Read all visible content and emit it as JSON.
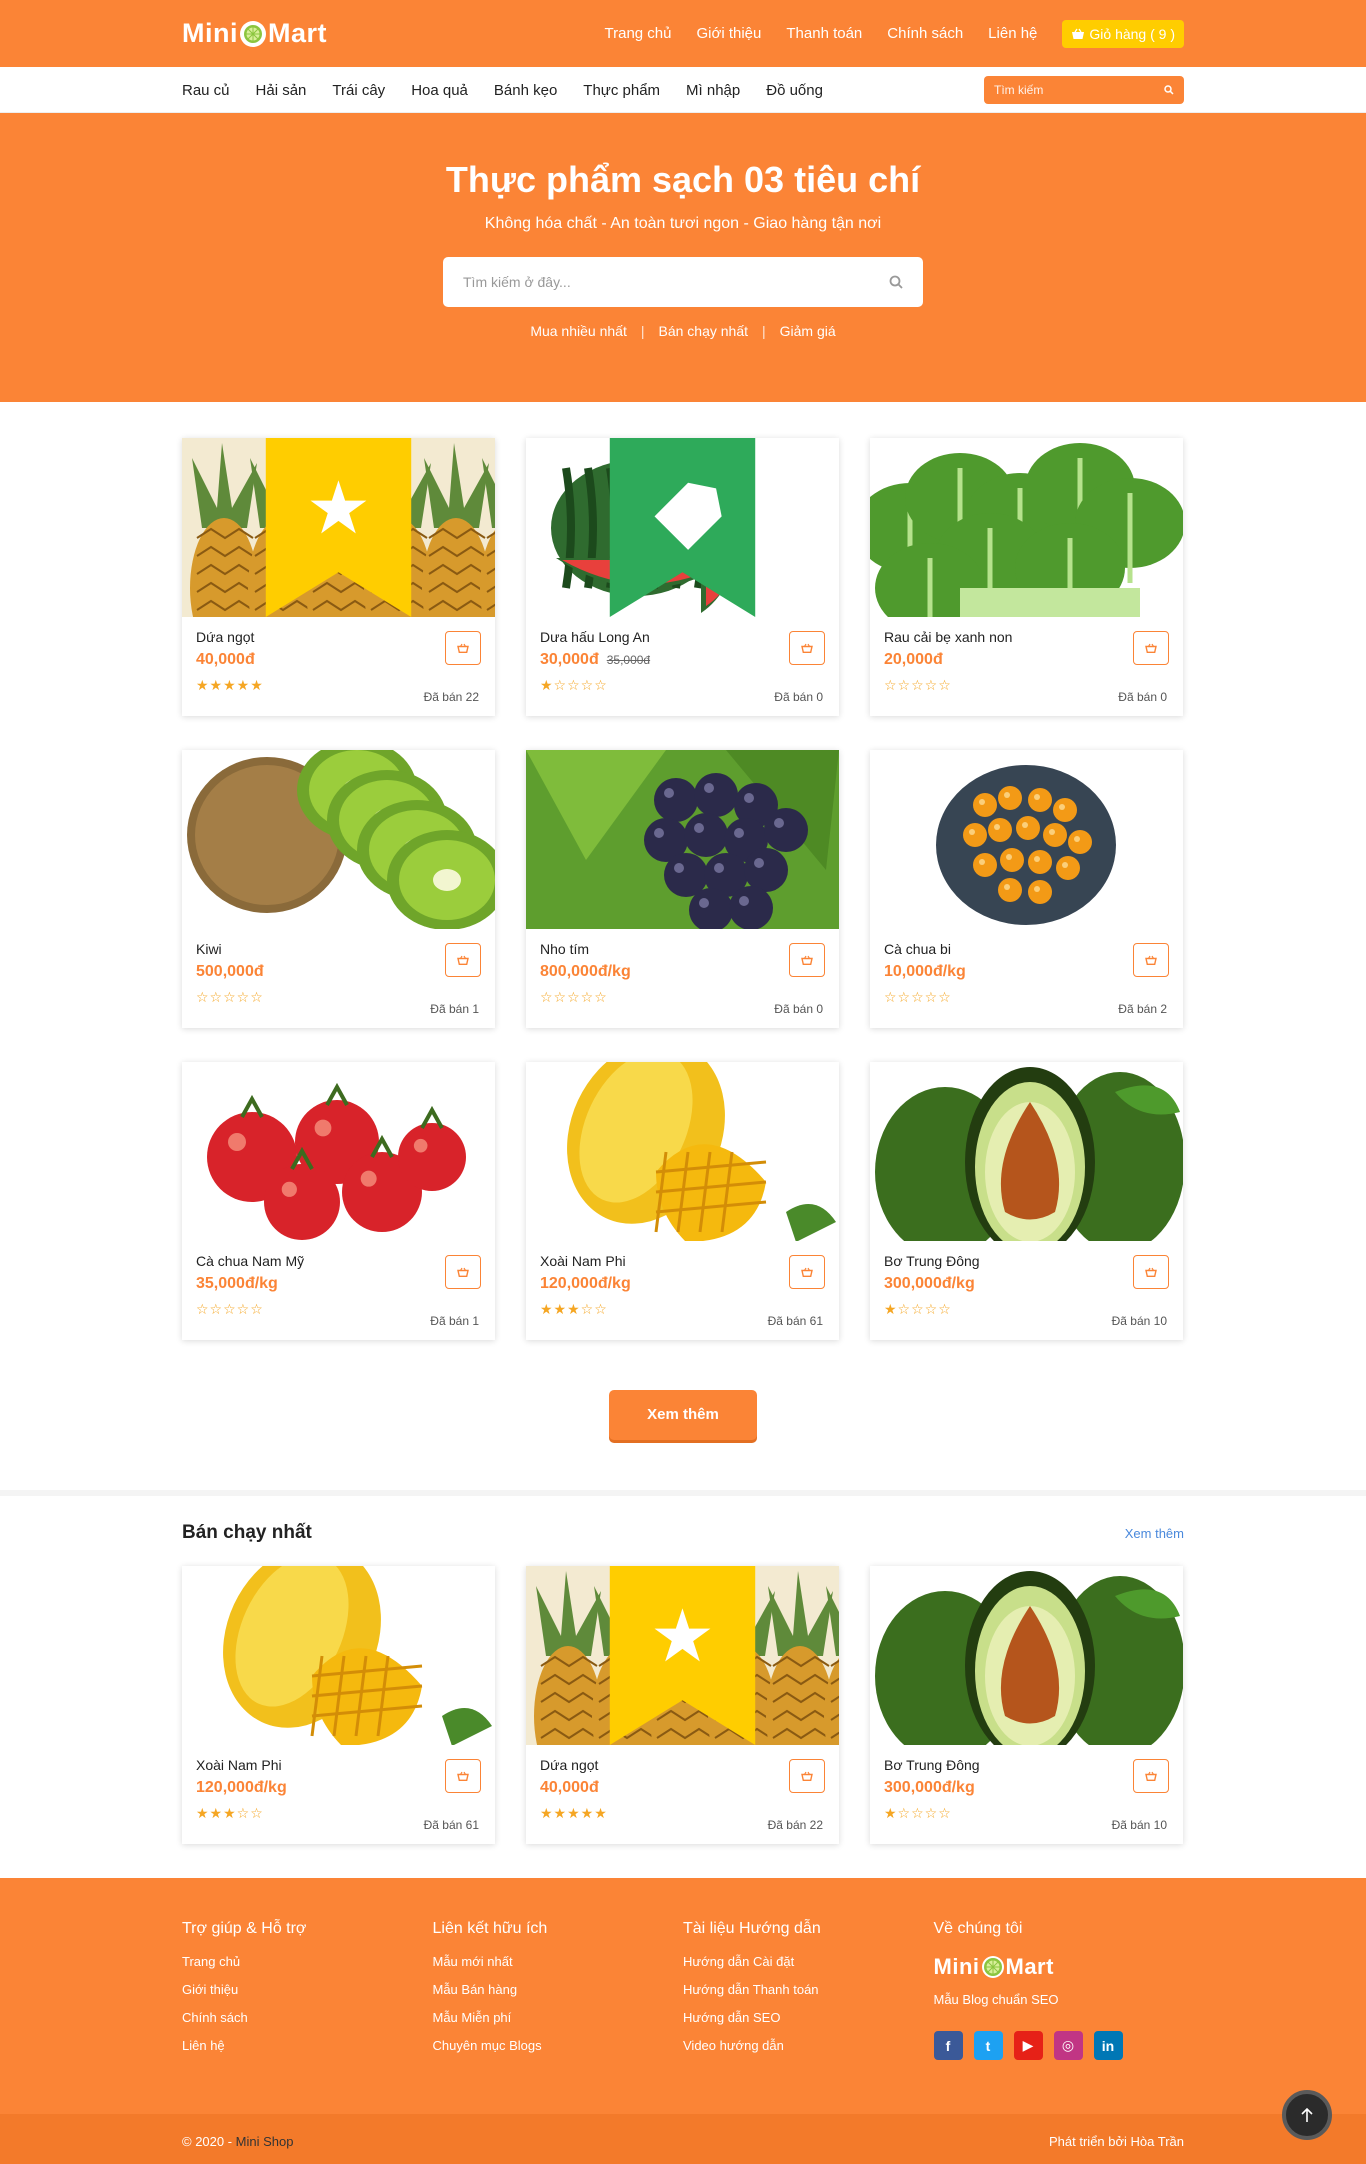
{
  "brand": {
    "part1": "Mini",
    "part2": "Mart"
  },
  "topnav": {
    "items": [
      "Trang chủ",
      "Giới thiệu",
      "Thanh toán",
      "Chính sách",
      "Liên hệ"
    ],
    "cart_label": "Giỏ hàng ( 9 )"
  },
  "catnav": {
    "items": [
      "Rau củ",
      "Hải sản",
      "Trái cây",
      "Hoa quả",
      "Bánh kẹo",
      "Thực phẩm",
      "Mì nhập",
      "Đồ uống"
    ],
    "search_placeholder": "Tìm kiếm"
  },
  "hero": {
    "title": "Thực phẩm sạch 03 tiêu chí",
    "subtitle": "Không hóa chất - An toàn tươi ngon - Giao hàng tận nơi",
    "search_placeholder": "Tìm kiếm ở đây...",
    "links": [
      "Mua nhiều nhất",
      "Bán chạy nhất",
      "Giảm giá"
    ]
  },
  "products": [
    {
      "name": "Dứa ngọt",
      "price": "40,000đ",
      "old_price": "",
      "rating": 5,
      "sold": "Đã bán 22",
      "image": "pineapple",
      "badge": "star"
    },
    {
      "name": "Dưa hấu Long An",
      "price": "30,000đ",
      "old_price": "35,000đ",
      "rating": 1,
      "sold": "Đã bán 0",
      "image": "watermelon",
      "badge": "tag"
    },
    {
      "name": "Rau cải bẹ xanh non",
      "price": "20,000đ",
      "old_price": "",
      "rating": 0,
      "sold": "Đã bán 0",
      "image": "greens",
      "badge": ""
    },
    {
      "name": "Kiwi",
      "price": "500,000đ",
      "old_price": "",
      "rating": 0,
      "sold": "Đã bán 1",
      "image": "kiwi",
      "badge": ""
    },
    {
      "name": "Nho tím",
      "price": "800,000đ/kg",
      "old_price": "",
      "rating": 0,
      "sold": "Đã bán 0",
      "image": "grapes",
      "badge": ""
    },
    {
      "name": "Cà chua bi",
      "price": "10,000đ/kg",
      "old_price": "",
      "rating": 0,
      "sold": "Đã bán 2",
      "image": "cherrytomato",
      "badge": ""
    },
    {
      "name": "Cà chua Nam Mỹ",
      "price": "35,000đ/kg",
      "old_price": "",
      "rating": 0,
      "sold": "Đã bán 1",
      "image": "tomato",
      "badge": ""
    },
    {
      "name": "Xoài Nam Phi",
      "price": "120,000đ/kg",
      "old_price": "",
      "rating": 3,
      "sold": "Đã bán 61",
      "image": "mango",
      "badge": ""
    },
    {
      "name": "Bơ Trung Đông",
      "price": "300,000đ/kg",
      "old_price": "",
      "rating": 1,
      "sold": "Đã bán 10",
      "image": "avocado",
      "badge": ""
    }
  ],
  "more_button": "Xem thêm",
  "bestsellers": {
    "title": "Bán chạy nhất",
    "more_link": "Xem thêm",
    "items": [
      {
        "name": "Xoài Nam Phi",
        "price": "120,000đ/kg",
        "old_price": "",
        "rating": 3,
        "sold": "Đã bán 61",
        "image": "mango",
        "badge": ""
      },
      {
        "name": "Dứa ngọt",
        "price": "40,000đ",
        "old_price": "",
        "rating": 5,
        "sold": "Đã bán 22",
        "image": "pineapple",
        "badge": "star"
      },
      {
        "name": "Bơ Trung Đông",
        "price": "300,000đ/kg",
        "old_price": "",
        "rating": 1,
        "sold": "Đã bán 10",
        "image": "avocado",
        "badge": ""
      }
    ]
  },
  "footer": {
    "columns": [
      {
        "title": "Trợ giúp & Hỗ trợ",
        "links": [
          "Trang chủ",
          "Giới thiệu",
          "Chính sách",
          "Liên hệ"
        ]
      },
      {
        "title": "Liên kết hữu ích",
        "links": [
          "Mẫu mới nhất",
          "Mẫu Bán hàng",
          "Mẫu Miễn phí",
          "Chuyên mục Blogs"
        ]
      },
      {
        "title": "Tài liệu Hướng dẫn",
        "links": [
          "Hướng dẫn Cài đặt",
          "Hướng dẫn Thanh toán",
          "Hướng dẫn SEO",
          "Video hướng dẫn"
        ]
      }
    ],
    "about_title": "Về chúng tôi",
    "about_tagline": "Mẫu Blog chuẩn SEO",
    "socials": [
      {
        "icon": "facebook-icon",
        "glyph": "f",
        "color": "#3b5998"
      },
      {
        "icon": "twitter-icon",
        "glyph": "t",
        "color": "#1da1f2"
      },
      {
        "icon": "youtube-icon",
        "glyph": "▶",
        "color": "#e62117"
      },
      {
        "icon": "instagram-icon",
        "glyph": "◎",
        "color": "#c13584"
      },
      {
        "icon": "linkedin-icon",
        "glyph": "in",
        "color": "#0077b5"
      }
    ],
    "copyright_prefix": "© 2020 - ",
    "copyright_brand": "Mini Shop",
    "credit": "Phát triển bởi Hòa Trần"
  },
  "colors": {
    "primary": "#fb8436",
    "cart_yellow": "#ffcd00",
    "star": "#f5a623"
  }
}
